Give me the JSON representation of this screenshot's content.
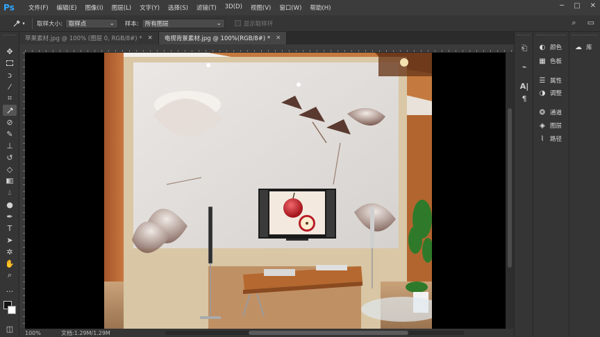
{
  "app": {
    "logo": "Ps"
  },
  "menu": [
    "文件(F)",
    "编辑(E)",
    "图像(I)",
    "图层(L)",
    "文字(Y)",
    "选择(S)",
    "滤镜(T)",
    "3D(D)",
    "视图(V)",
    "窗口(W)",
    "帮助(H)"
  ],
  "window_controls": {
    "minimize": "─",
    "restore": "□",
    "close": "✕"
  },
  "options": {
    "tool_icon": "eyedropper-icon",
    "sample_size_label": "取样大小:",
    "sample_size_value": "取样点",
    "sample_label": "样本:",
    "sample_value": "所有图层",
    "show_ring_label": "显示取样环"
  },
  "tabs": [
    {
      "label": "苹果素材.jpg @ 100% (图层 0, RGB/8#) *",
      "active": false
    },
    {
      "label": "电视背景素材.jpg @ 100%(RGB/8#) *",
      "active": true
    }
  ],
  "status": {
    "zoom": "100%",
    "doc": "文档:1.29M/1.29M"
  },
  "panels": [
    {
      "icon": "color-icon",
      "glyph": "◐",
      "label": "颜色"
    },
    {
      "icon": "swatches-icon",
      "glyph": "▦",
      "label": "色板"
    },
    {
      "icon": "properties-icon",
      "glyph": "☰",
      "label": "属性"
    },
    {
      "icon": "adjustments-icon",
      "glyph": "◑",
      "label": "调整"
    },
    {
      "icon": "channels-icon",
      "glyph": "❂",
      "label": "通道"
    },
    {
      "icon": "layers-icon",
      "glyph": "◈",
      "label": "图层"
    },
    {
      "icon": "paths-icon",
      "glyph": "⌇",
      "label": "路径"
    }
  ],
  "library": {
    "glyph": "☁",
    "label": "库"
  },
  "colors": {
    "accent": "#31a8ff",
    "app_bg": "#282828",
    "panel_bg": "#353535"
  }
}
